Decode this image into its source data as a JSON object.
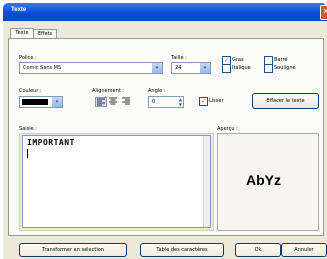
{
  "window": {
    "title": "Texte",
    "close_glyph": "✕"
  },
  "tabs": [
    {
      "label": "Texte"
    },
    {
      "label": "Effets"
    }
  ],
  "police": {
    "label": "Police :",
    "value": "Comic Sans MS"
  },
  "taille": {
    "label": "Taille :",
    "value": "24"
  },
  "checks": {
    "gras": {
      "label": "Gras",
      "checked": true
    },
    "barre": {
      "label": "Barré",
      "checked": false
    },
    "italique": {
      "label": "Italique",
      "checked": false
    },
    "souligne": {
      "label": "Souligné",
      "checked": false
    }
  },
  "couleur": {
    "label": "Couleur :",
    "value_color": "#000000"
  },
  "alignement": {
    "label": "Alignement :"
  },
  "angle": {
    "label": "Angle :",
    "value": "0"
  },
  "lisser": {
    "label": "Lisser",
    "checked": true
  },
  "effacer_button": "Effacer le texte",
  "saisie": {
    "label": "Saisie :",
    "text": "IMPORTANT"
  },
  "apercu": {
    "label": "Aperçu :",
    "text": "AbYz"
  },
  "bottom_buttons": {
    "transformer": "Transformer en sélection",
    "table": "Table des caractères",
    "ok": "Ok",
    "annuler": "Annuler"
  },
  "icons": {
    "check": "✓",
    "dropdown": "▾",
    "spin_up": "▲",
    "spin_down": "▼"
  }
}
